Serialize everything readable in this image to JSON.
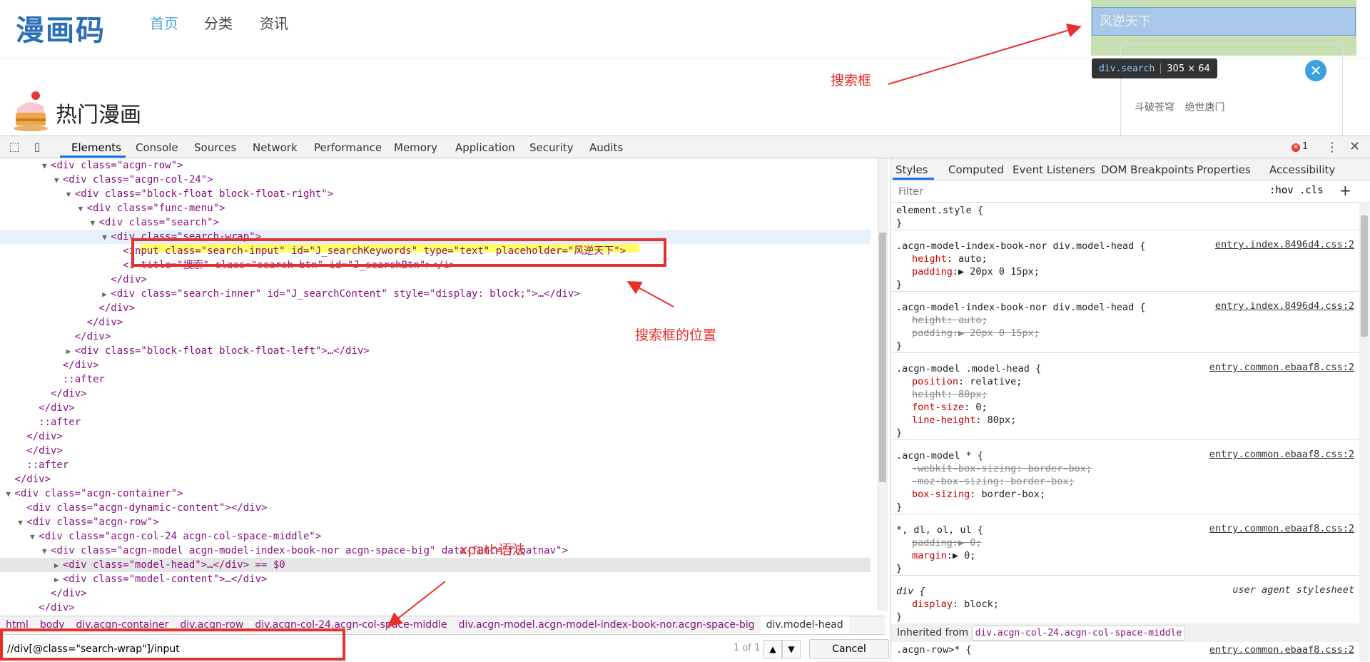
{
  "site": {
    "logo": "漫画码",
    "nav": [
      "首页",
      "分类",
      "资讯"
    ],
    "section_title": "热门漫画",
    "search_placeholder": "风逆天下",
    "tooltip_tag": "div.search",
    "tooltip_size": "305 × 64",
    "hot_keywords": "斗破苍穹 绝世唐门"
  },
  "annotations": {
    "search_box": "搜索框",
    "search_box_position": "搜索框的位置",
    "xpath": "xpath语法"
  },
  "devtools": {
    "tabs": [
      "Elements",
      "Console",
      "Sources",
      "Network",
      "Performance",
      "Memory",
      "Application",
      "Security",
      "Audits"
    ],
    "error_count": "1",
    "tree": [
      {
        "indent": 7,
        "toggle": "▼",
        "html": "<div class=\"acgn-row\">"
      },
      {
        "indent": 9,
        "toggle": "▼",
        "html": "<div class=\"acgn-col-24\">"
      },
      {
        "indent": 11,
        "toggle": "▼",
        "html": "<div class=\"block-float block-float-right\">"
      },
      {
        "indent": 13,
        "toggle": "▼",
        "html": "<div class=\"func-menu\">"
      },
      {
        "indent": 15,
        "toggle": "▼",
        "html": "<div class=\"search\">"
      },
      {
        "indent": 17,
        "toggle": "▼",
        "html": "<div class=\"search-wrap\">"
      },
      {
        "indent": 19,
        "toggle": "",
        "html": "<input class=\"search-input\" id=\"J_searchKeywords\" type=\"text\" placeholder=\"风逆天下\">"
      },
      {
        "indent": 19,
        "toggle": "",
        "html": "<i title=\"搜索\" class=\"search-btn\" id=\"J_searchBtn\"></i>"
      },
      {
        "indent": 17,
        "toggle": "",
        "html": "</div>"
      },
      {
        "indent": 17,
        "toggle": "▶",
        "html": "<div class=\"search-inner\" id=\"J_searchContent\" style=\"display: block;\">…</div>"
      },
      {
        "indent": 15,
        "toggle": "",
        "html": "</div>"
      },
      {
        "indent": 13,
        "toggle": "",
        "html": "</div>"
      },
      {
        "indent": 11,
        "toggle": "",
        "html": "</div>"
      },
      {
        "indent": 11,
        "toggle": "▶",
        "html": "<div class=\"block-float block-float-left\">…</div>"
      },
      {
        "indent": 9,
        "toggle": "",
        "html": "</div>"
      },
      {
        "indent": 9,
        "toggle": "",
        "html": "::after"
      },
      {
        "indent": 7,
        "toggle": "",
        "html": "</div>"
      },
      {
        "indent": 5,
        "toggle": "",
        "html": "</div>"
      },
      {
        "indent": 5,
        "toggle": "",
        "html": "::after"
      },
      {
        "indent": 3,
        "toggle": "",
        "html": "</div>"
      },
      {
        "indent": 3,
        "toggle": "",
        "html": "</div>"
      },
      {
        "indent": 3,
        "toggle": "",
        "html": "::after"
      },
      {
        "indent": 1,
        "toggle": "",
        "html": "</div>"
      },
      {
        "indent": 1,
        "toggle": "▼",
        "html": "<div class=\"acgn-container\">"
      },
      {
        "indent": 3,
        "toggle": "",
        "html": "<div class=\"acgn-dynamic-content\"></div>"
      },
      {
        "indent": 3,
        "toggle": "▼",
        "html": "<div class=\"acgn-row\">"
      },
      {
        "indent": 5,
        "toggle": "▼",
        "html": "<div class=\"acgn-col-24 acgn-col-space-middle\">"
      },
      {
        "indent": 7,
        "toggle": "▼",
        "html": "<div class=\"acgn-model acgn-model-index-book-nor acgn-space-big\" data-func=\"floatnav\">"
      },
      {
        "indent": 9,
        "toggle": "▶",
        "html": "<div class=\"model-head\">…</div> == $0"
      },
      {
        "indent": 9,
        "toggle": "▶",
        "html": "<div class=\"model-content\">…</div>"
      },
      {
        "indent": 7,
        "toggle": "",
        "html": "</div>"
      },
      {
        "indent": 5,
        "toggle": "",
        "html": "</div>"
      }
    ],
    "breadcrumb": [
      "html",
      "body",
      "div.acgn-container",
      "div.acgn-row",
      "div.acgn-col-24.acgn-col-space-middle",
      "div.acgn-model.acgn-model-index-book-nor.acgn-space-big",
      "div.model-head"
    ],
    "find": {
      "value": "//div[@class=\"search-wrap\"]/input",
      "count": "1 of 1",
      "cancel": "Cancel"
    }
  },
  "styles_pane": {
    "tabs": [
      "Styles",
      "Computed",
      "Event Listeners",
      "DOM Breakpoints",
      "Properties",
      "Accessibility"
    ],
    "filter_placeholder": "Filter",
    "hov": ":hov",
    "cls": ".cls",
    "plus": "+",
    "rules": [
      {
        "selector": "element.style {",
        "source": "",
        "ua": false,
        "props": []
      },
      {
        "selector": ".acgn-model-index-book-nor div.model-head {",
        "source": "entry.index.8496d4.css:2",
        "ua": false,
        "props": [
          {
            "t": "height: auto;",
            "s": false
          },
          {
            "t": "padding:▶ 20px 0 15px;",
            "s": false
          }
        ]
      },
      {
        "selector": ".acgn-model-index-book-nor div.model-head {",
        "source": "entry.index.8496d4.css:2",
        "ua": false,
        "props": [
          {
            "t": "height: auto;",
            "s": true
          },
          {
            "t": "padding:▶ 20px 0 15px;",
            "s": true
          }
        ]
      },
      {
        "selector": ".acgn-model .model-head {",
        "source": "entry.common.ebaaf8.css:2",
        "ua": false,
        "props": [
          {
            "t": "position: relative;",
            "s": false
          },
          {
            "t": "height: 80px;",
            "s": true
          },
          {
            "t": "font-size: 0;",
            "s": false
          },
          {
            "t": "line-height: 80px;",
            "s": false
          }
        ]
      },
      {
        "selector": ".acgn-model * {",
        "source": "entry.common.ebaaf8.css:2",
        "ua": false,
        "props": [
          {
            "t": "-webkit-box-sizing: border-box;",
            "s": true
          },
          {
            "t": "-moz-box-sizing: border-box;",
            "s": true
          },
          {
            "t": "box-sizing: border-box;",
            "s": false
          }
        ]
      },
      {
        "selector": "*, dl, ol, ul {",
        "source": "entry.common.ebaaf8.css:2",
        "ua": false,
        "props": [
          {
            "t": "padding:▶ 0;",
            "s": true
          },
          {
            "t": "margin:▶ 0;",
            "s": false
          }
        ]
      },
      {
        "selector": "div {",
        "source": "user agent stylesheet",
        "ua": true,
        "props": [
          {
            "t": "display: block;",
            "s": false
          }
        ]
      }
    ],
    "inherited_label": "Inherited from",
    "inherited_selector": "div.acgn-col-24.acgn-col-space-middle",
    "last_selector": ".acgn-row>* {",
    "last_source": "entry.common.ebaaf8.css:2"
  }
}
